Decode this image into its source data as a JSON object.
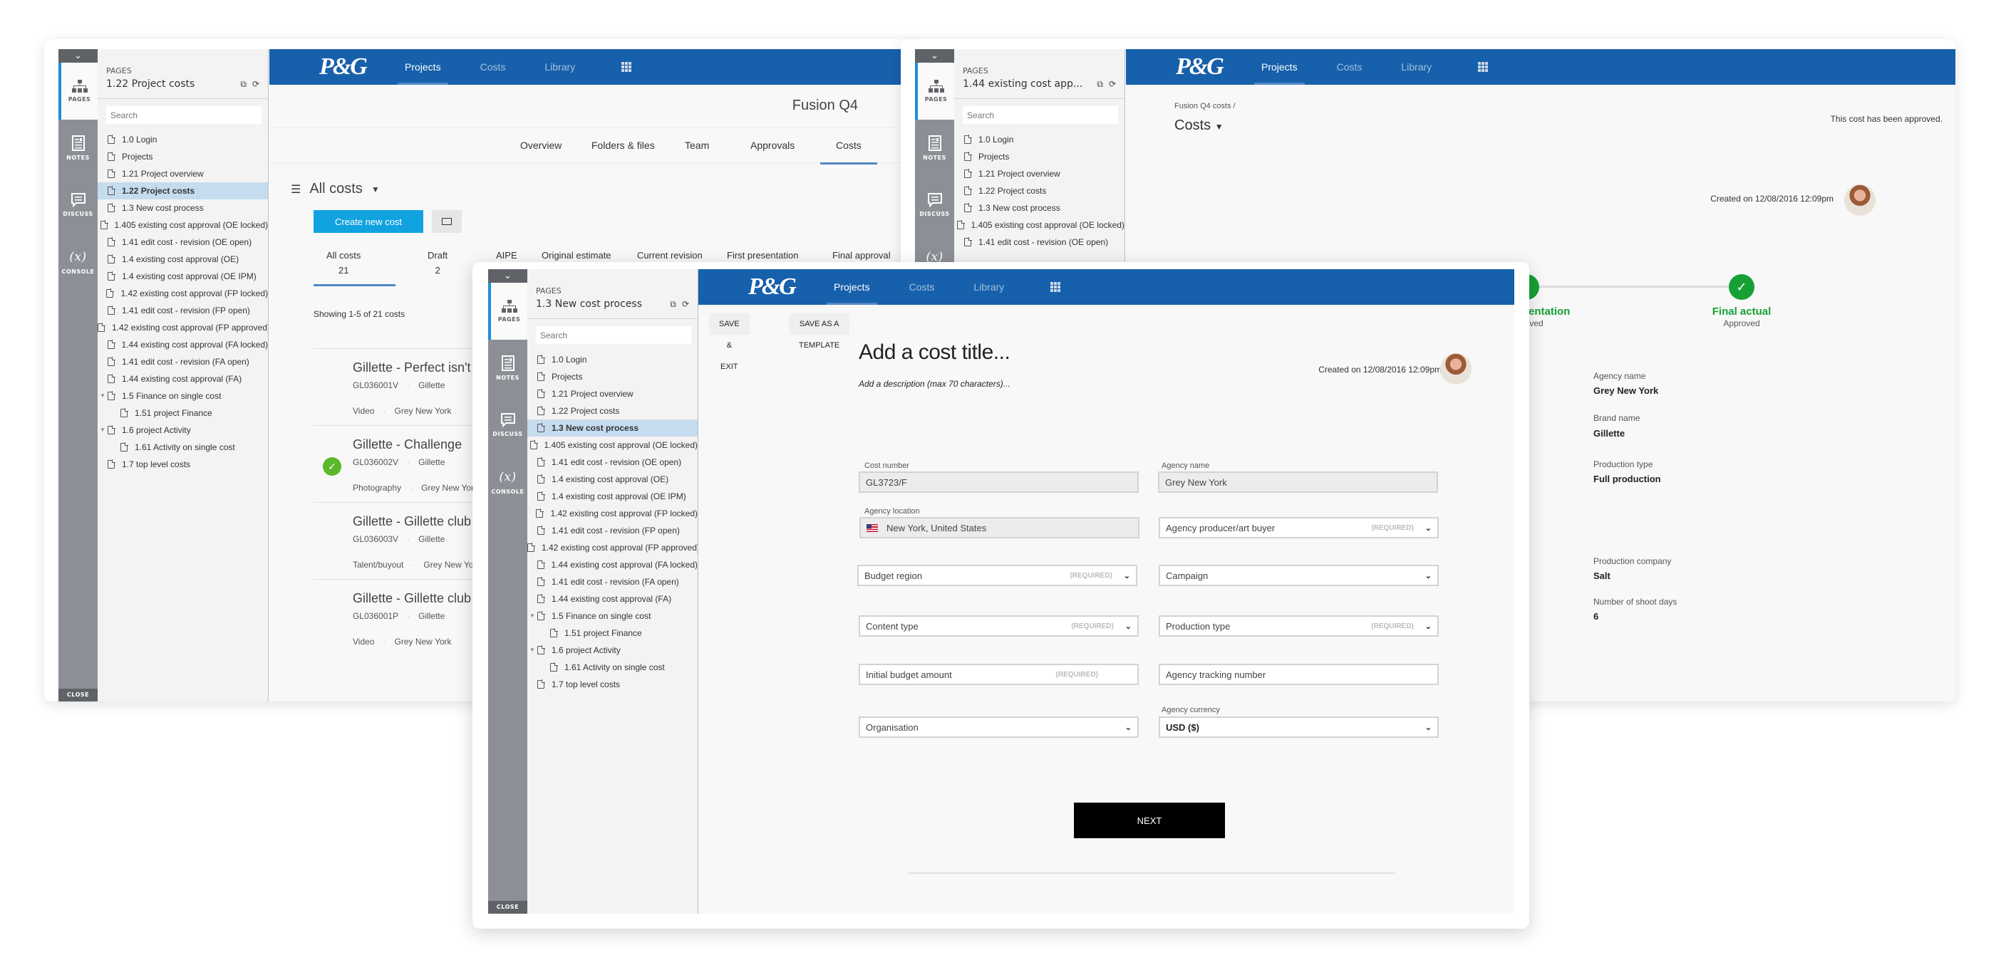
{
  "common": {
    "rail": {
      "pages": "PAGES",
      "notes": "NOTES",
      "discuss": "DISCUSS",
      "console_symbol": "(x)",
      "console": "CONSOLE",
      "close": "CLOSE"
    },
    "pages_label": "PAGES",
    "search_placeholder": "Search",
    "logo": "P&G",
    "nav": [
      "Projects",
      "Costs",
      "Library"
    ],
    "page_tree": [
      {
        "label": "1.0 Login",
        "indent": 0
      },
      {
        "label": "Projects",
        "indent": 0
      },
      {
        "label": "1.21 Project overview",
        "indent": 0
      },
      {
        "label": "1.22 Project costs",
        "indent": 0
      },
      {
        "label": "1.3 New cost process",
        "indent": 0
      },
      {
        "label": "1.405 existing cost approval (OE locked)",
        "indent": 0
      },
      {
        "label": "1.41 edit cost - revision (OE open)",
        "indent": 0
      },
      {
        "label": "1.4 existing cost approval (OE)",
        "indent": 0
      },
      {
        "label": "1.4 existing cost approval (OE IPM)",
        "indent": 0
      },
      {
        "label": "1.42 existing cost approval (FP locked)",
        "indent": 0
      },
      {
        "label": "1.41 edit cost - revision (FP open)",
        "indent": 0
      },
      {
        "label": "1.42 existing cost approval (FP approved)",
        "indent": 0
      },
      {
        "label": "1.44 existing cost approval (FA locked)",
        "indent": 0
      },
      {
        "label": "1.41 edit cost - revision (FA open)",
        "indent": 0
      },
      {
        "label": "1.44 existing cost approval (FA)",
        "indent": 0
      },
      {
        "label": "1.5 Finance on single cost",
        "indent": 0,
        "expanded": true
      },
      {
        "label": "1.51 project Finance",
        "indent": 1
      },
      {
        "label": "1.6 project Activity",
        "indent": 0,
        "expanded": true
      },
      {
        "label": "1.61 Activity on single cost",
        "indent": 1
      },
      {
        "label": "1.7 top level costs",
        "indent": 0
      }
    ]
  },
  "left_screen": {
    "page_title": "1.22 Project costs",
    "active_page_index": 3,
    "project_name": "Fusion Q4",
    "subtabs": [
      "Overview",
      "Folders & files",
      "Team",
      "Approvals",
      "Costs"
    ],
    "active_subtab": "Costs",
    "list_title": "All costs",
    "create_button": "Create new cost",
    "stats": [
      {
        "label": "All costs",
        "count": "21"
      },
      {
        "label": "Draft",
        "count": "2"
      },
      {
        "label": "AIPE",
        "count": ""
      },
      {
        "label": "Original estimate",
        "count": ""
      },
      {
        "label": "Current revision",
        "count": ""
      },
      {
        "label": "First presentation",
        "count": ""
      },
      {
        "label": "Final approval",
        "count": ""
      }
    ],
    "showing": "Showing 1-5 of 21 costs",
    "costs": [
      {
        "title": "Gillette - Perfect isn't",
        "code": "GL036001V",
        "brand": "Gillette",
        "type": "Video",
        "agency": "Grey New York",
        "approved": false
      },
      {
        "title": "Gillette - Challenge",
        "code": "GL036002V",
        "brand": "Gillette",
        "type": "Photography",
        "agency": "Grey New York",
        "approved": true
      },
      {
        "title": "Gillette - Gillette club",
        "code": "GL036003V",
        "brand": "Gillette",
        "type": "Talent/buyout",
        "agency": "Grey New York",
        "approved": false
      },
      {
        "title": "Gillette - Gillette club",
        "code": "GL036001P",
        "brand": "Gillette",
        "type": "Video",
        "agency": "Grey New York",
        "approved": false
      }
    ]
  },
  "right_screen": {
    "page_title": "1.44 existing cost app...",
    "breadcrumb": "Fusion Q4 costs /",
    "title": "Costs",
    "approved_message": "This cost has been approved.",
    "created": "Created on 12/08/2016 12:09pm",
    "steps": [
      {
        "label": "First presentation",
        "status": "Approved"
      },
      {
        "label": "Final actual",
        "status": "Approved"
      }
    ],
    "details": [
      {
        "label": "Agency name",
        "value": "Grey New York"
      },
      {
        "label": "Brand name",
        "value": "Gillette"
      },
      {
        "label": "Production type",
        "value": "Full production"
      },
      {
        "label": "Production company",
        "value": "Salt"
      },
      {
        "label": "Number of  shoot days",
        "value": "6"
      }
    ]
  },
  "front_screen": {
    "page_title": "1.3 New cost process",
    "active_page_index": 4,
    "toolbar": {
      "save_exit": "SAVE & EXIT",
      "save_template": "SAVE AS A TEMPLATE"
    },
    "title_placeholder": "Add a cost title...",
    "description_placeholder": "Add a description (max 70 characters)...",
    "created": "Created on 12/08/2016 12:09pm",
    "required_tag": "(REQUIRED)",
    "fields": {
      "cost_number": {
        "label": "Cost number",
        "value": "GL3723/F"
      },
      "agency_name": {
        "label": "Agency name",
        "value": "Grey New York"
      },
      "agency_location": {
        "label": "Agency location",
        "value": "New York, United States"
      },
      "agency_producer": {
        "placeholder": "Agency producer/art buyer",
        "required": true
      },
      "budget_region": {
        "placeholder": "Budget region",
        "required": true
      },
      "campaign": {
        "placeholder": "Campaign",
        "required": false
      },
      "content_type": {
        "placeholder": "Content type",
        "required": true
      },
      "production_type": {
        "placeholder": "Production type",
        "required": true
      },
      "initial_budget": {
        "placeholder": "Initial budget amount",
        "required": true
      },
      "agency_tracking": {
        "placeholder": "Agency tracking number",
        "required": false
      },
      "organisation": {
        "placeholder": "Organisation",
        "required": false
      },
      "agency_currency": {
        "label": "Agency currency",
        "value": "USD ($)"
      }
    },
    "next_button": "NEXT"
  }
}
